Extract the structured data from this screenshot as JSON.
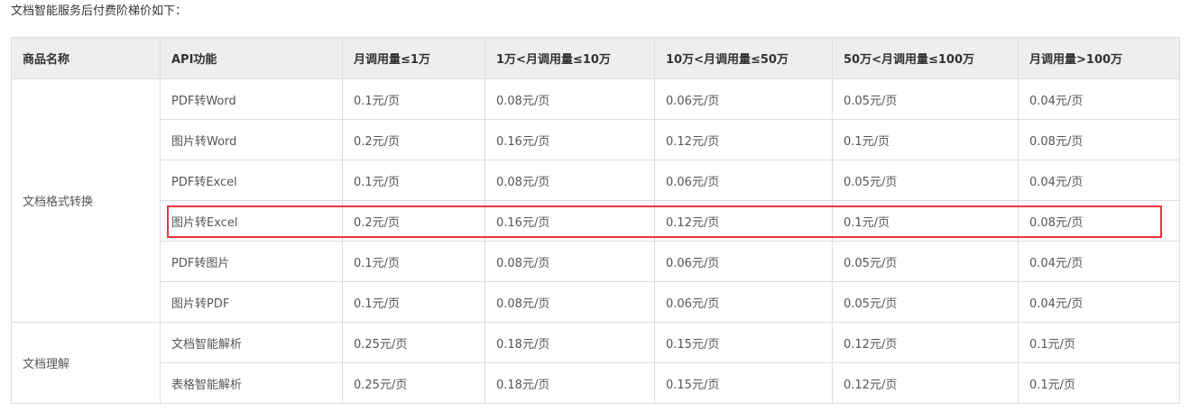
{
  "intro": "文档智能服务后付费阶梯价如下：",
  "table": {
    "headers": [
      "商品名称",
      "API功能",
      "月调用量≤1万",
      "1万<月调用量≤10万",
      "10万<月调用量≤50万",
      "50万<月调用量≤100万",
      "月调用量>100万"
    ],
    "groups": [
      {
        "name": "文档格式转换",
        "rows": [
          {
            "api": "PDF转Word",
            "prices": [
              "0.1元/页",
              "0.08元/页",
              "0.06元/页",
              "0.05元/页",
              "0.04元/页"
            ]
          },
          {
            "api": "图片转Word",
            "prices": [
              "0.2元/页",
              "0.16元/页",
              "0.12元/页",
              "0.1元/页",
              "0.08元/页"
            ]
          },
          {
            "api": "PDF转Excel",
            "prices": [
              "0.1元/页",
              "0.08元/页",
              "0.06元/页",
              "0.05元/页",
              "0.04元/页"
            ]
          },
          {
            "api": "图片转Excel",
            "prices": [
              "0.2元/页",
              "0.16元/页",
              "0.12元/页",
              "0.1元/页",
              "0.08元/页"
            ],
            "highlighted": true
          },
          {
            "api": "PDF转图片",
            "prices": [
              "0.1元/页",
              "0.08元/页",
              "0.06元/页",
              "0.05元/页",
              "0.04元/页"
            ]
          },
          {
            "api": "图片转PDF",
            "prices": [
              "0.1元/页",
              "0.08元/页",
              "0.06元/页",
              "0.05元/页",
              "0.04元/页"
            ]
          }
        ]
      },
      {
        "name": "文档理解",
        "rows": [
          {
            "api": "文档智能解析",
            "prices": [
              "0.25元/页",
              "0.18元/页",
              "0.15元/页",
              "0.12元/页",
              "0.1元/页"
            ]
          },
          {
            "api": "表格智能解析",
            "prices": [
              "0.25元/页",
              "0.18元/页",
              "0.15元/页",
              "0.12元/页",
              "0.1元/页"
            ]
          }
        ]
      }
    ]
  },
  "colors": {
    "highlight_border": "#e5383b",
    "header_background": "#eeeeee",
    "grid_line": "#dcdcdc"
  }
}
